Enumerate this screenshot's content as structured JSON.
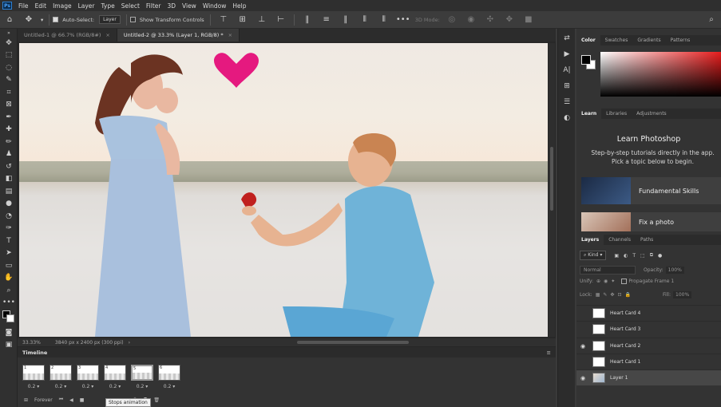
{
  "menubar": {
    "logo": "Ps",
    "items": [
      "File",
      "Edit",
      "Image",
      "Layer",
      "Type",
      "Select",
      "Filter",
      "3D",
      "View",
      "Window",
      "Help"
    ]
  },
  "options": {
    "auto_select_label": "Auto-Select:",
    "auto_select_value": "Layer",
    "show_transform_label": "Show Transform Controls",
    "mode_3d_label": "3D Mode:"
  },
  "doc_tabs": [
    {
      "label": "Untitled-1 @ 66.7% (RGB/8#)",
      "active": false
    },
    {
      "label": "Untitled-2 @ 33.3% (Layer 1, RGB/8) *",
      "active": true
    }
  ],
  "status": {
    "zoom": "33.33%",
    "doc_info": "3840 px x 2400 px (300 ppi)"
  },
  "timeline": {
    "title": "Timeline",
    "frames": [
      {
        "num": "1",
        "delay": "0.2 ▾",
        "selected": false
      },
      {
        "num": "2",
        "delay": "0.2 ▾",
        "selected": false
      },
      {
        "num": "3",
        "delay": "0.2 ▾",
        "selected": false
      },
      {
        "num": "4",
        "delay": "0.2 ▾",
        "selected": false
      },
      {
        "num": "5",
        "delay": "0.2 ▾",
        "selected": true
      },
      {
        "num": "6",
        "delay": "0.2 ▾",
        "selected": false
      }
    ],
    "loop_value": "Forever",
    "tooltip": "Stops animation"
  },
  "color_panel": {
    "tabs": [
      "Color",
      "Swatches",
      "Gradients",
      "Patterns"
    ],
    "accent": "#e81d1d"
  },
  "learn_panel": {
    "tabs": [
      "Learn",
      "Libraries",
      "Adjustments"
    ],
    "title": "Learn Photoshop",
    "description": "Step-by-step tutorials directly in the app. Pick a topic below to begin.",
    "cards": [
      "Fundamental Skills",
      "Fix a photo"
    ]
  },
  "layers_panel": {
    "tabs": [
      "Layers",
      "Channels",
      "Paths"
    ],
    "kind_label": "Kind",
    "blend_mode": "Normal",
    "opacity_label": "Opacity:",
    "opacity_value": "100%",
    "unify_label": "Unify:",
    "propagate_label": "Propagate Frame 1",
    "lock_label": "Lock:",
    "fill_label": "Fill:",
    "fill_value": "100%",
    "layers": [
      {
        "name": "Heart Card 4",
        "visible": false,
        "selected": false
      },
      {
        "name": "Heart Card 3",
        "visible": false,
        "selected": false
      },
      {
        "name": "Heart Card 2",
        "visible": true,
        "selected": false
      },
      {
        "name": "Heart Card 1",
        "visible": false,
        "selected": false
      },
      {
        "name": "Layer 1",
        "visible": true,
        "selected": true
      }
    ]
  }
}
